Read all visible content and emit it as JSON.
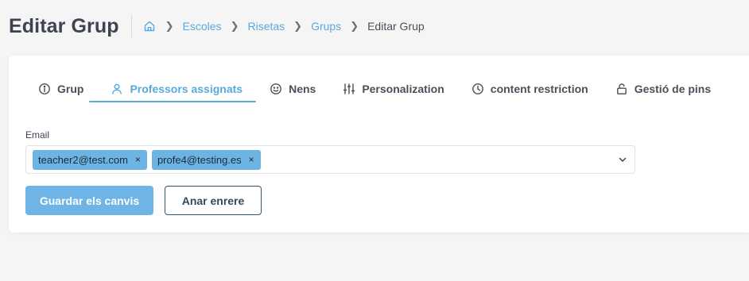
{
  "header": {
    "title": "Editar Grup",
    "breadcrumb": {
      "home_icon": "home-icon",
      "items": [
        "Escoles",
        "Risetas",
        "Grups"
      ],
      "current": "Editar Grup"
    }
  },
  "tabs": [
    {
      "label": "Grup",
      "icon": "info-icon"
    },
    {
      "label": "Professors assignats",
      "icon": "user-icon",
      "active": true
    },
    {
      "label": "Nens",
      "icon": "smile-icon"
    },
    {
      "label": "Personalization",
      "icon": "sliders-icon"
    },
    {
      "label": "content restriction",
      "icon": "clock-icon"
    },
    {
      "label": "Gestió de pins",
      "icon": "lock-icon"
    }
  ],
  "form": {
    "email_label": "Email",
    "selected_emails": [
      "teacher2@test.com",
      "profe4@testing.es"
    ],
    "remove_glyph": "×"
  },
  "buttons": {
    "save_label": "Guardar els canvis",
    "back_label": "Anar enrere"
  },
  "colors": {
    "accent": "#5aa9dc",
    "tag_bg": "#6cb4e4",
    "save_bg": "#6eb4e6",
    "back_border": "#34546e"
  }
}
